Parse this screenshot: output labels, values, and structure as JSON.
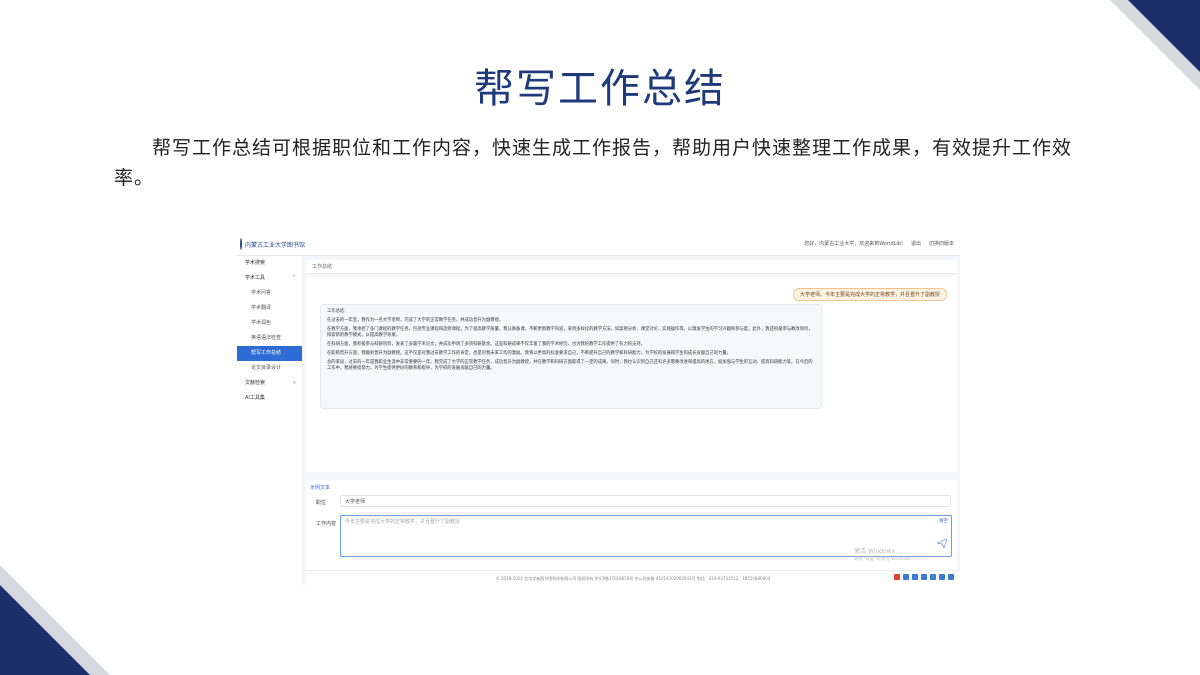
{
  "slide": {
    "title": "帮写工作总结",
    "description": "帮写工作总结可根据职位和工作内容，快速生成工作报告，帮助用户快速整理工作成果，有效提升工作效率。"
  },
  "colors": {
    "brand": "#1e3a7b",
    "active": "#2f6bd5",
    "user_bubble": "#fdf2e4"
  },
  "app": {
    "logo_text": "内蒙古工业大学图书馆",
    "top_right": {
      "greeting": "您好，内蒙古工业大学，欢迎来到WorldLib!",
      "logout": "退出",
      "switch": "切换旧版本"
    },
    "sidebar": [
      {
        "label": "学术搜索",
        "sub": false,
        "active": false,
        "chevron": ""
      },
      {
        "label": "学术工具",
        "sub": false,
        "active": false,
        "chevron": "^"
      },
      {
        "label": "学术问答",
        "sub": true,
        "active": false,
        "chevron": ""
      },
      {
        "label": "学术翻译",
        "sub": true,
        "active": false,
        "chevron": ""
      },
      {
        "label": "学术润色",
        "sub": true,
        "active": false,
        "chevron": ""
      },
      {
        "label": "英语语法检查",
        "sub": true,
        "active": false,
        "chevron": ""
      },
      {
        "label": "帮写工作总结",
        "sub": true,
        "active": true,
        "chevron": ""
      },
      {
        "label": "论文目录设计",
        "sub": true,
        "active": false,
        "chevron": ""
      },
      {
        "label": "文献检索",
        "sub": false,
        "active": false,
        "chevron": "v"
      },
      {
        "label": "AI工具集",
        "sub": false,
        "active": false,
        "chevron": ""
      }
    ],
    "content_title": "工作总结",
    "user_message": "大学老师。今年主要是完成大学的正常教学，并且晋升了副教授",
    "ai_response": [
      "工作总结：",
      "在过去的一年里，我作为一名大学老师，完成了大学的正常教学任务，并成功晋升为副教授。",
      "在教学方面，我承担了多门课程的教学任务，包括专业课程和选修课程。为了提高教学质量，我认真备课，不断更新教学内容，采用多样化的教学方法，如案例分析、课堂讨论、实践操作等，以激发学生的学习兴趣和参与度。此外，我还积极参与教改项目，探索新的教学模式，以提高教学效果。",
      "在科研方面，我积极参与科研项目，发表了多篇学术论文，并成功申请了多项科研基金。这些科研成果不仅丰富了我的学术经历，也为我的教学工作提供了有力的支持。",
      "在职称晋升方面，我顺利晋升为副教授。这不仅是对我过去教学工作的肯定，也是对我未来工作的激励。我将以更高的标准要求自己，不断提升自己的教学和科研能力，为学校的发展和学生的成长贡献自己的力量。",
      "总的来说，过去的一年是我职业生涯中非常重要的一年。我完成了大学的正常教学任务，成功晋升为副教授，并在教学和科研方面取得了一定的成果。同时，我也认识到自己还有许多需要改进和提高的地方，如加强与学生的互动、提高科研能力等。在今后的工作中，我将继续努力，为学生提供更好的教育和指导，为学校的发展贡献自己的力量。"
    ],
    "form": {
      "tab_label": "示例文本",
      "position_label": "职位",
      "position_value": "大学老师",
      "content_label": "工作内容",
      "content_placeholder": "今年主要是完成大学的正常教学，并且晋升了副教授",
      "area_tag": "清空"
    },
    "footer": "© 2018-2024 北京学者图书馆科技有限公司 版权所有    京ICP备17018659号    京公网安备 41018702002043号    电话：010-63731512、18510880804",
    "watermark": {
      "line1": "激活 Windows",
      "line2": "转到\"设置\"以激活 Windows。"
    }
  }
}
